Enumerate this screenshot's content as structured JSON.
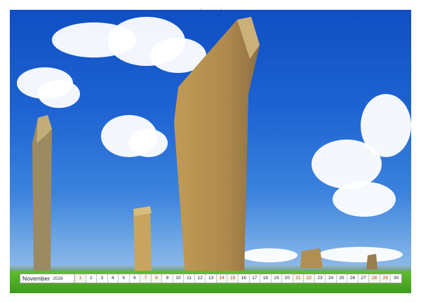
{
  "calendar": {
    "month": "November",
    "year": "2026",
    "days": [
      "1",
      "2",
      "3",
      "4",
      "5",
      "6",
      "7",
      "8",
      "9",
      "10",
      "11",
      "12",
      "13",
      "14",
      "15",
      "16",
      "17",
      "18",
      "19",
      "20",
      "21",
      "22",
      "23",
      "24",
      "25",
      "26",
      "27",
      "28",
      "29",
      "30"
    ],
    "weekend_days": [
      "1",
      "7",
      "8",
      "14",
      "15",
      "21",
      "22",
      "28",
      "29"
    ]
  },
  "colors": {
    "sky_top": "#0f4fc4",
    "stone": "#b89a5a",
    "grass": "#4aa823",
    "weekend_text": "#c0392b"
  }
}
